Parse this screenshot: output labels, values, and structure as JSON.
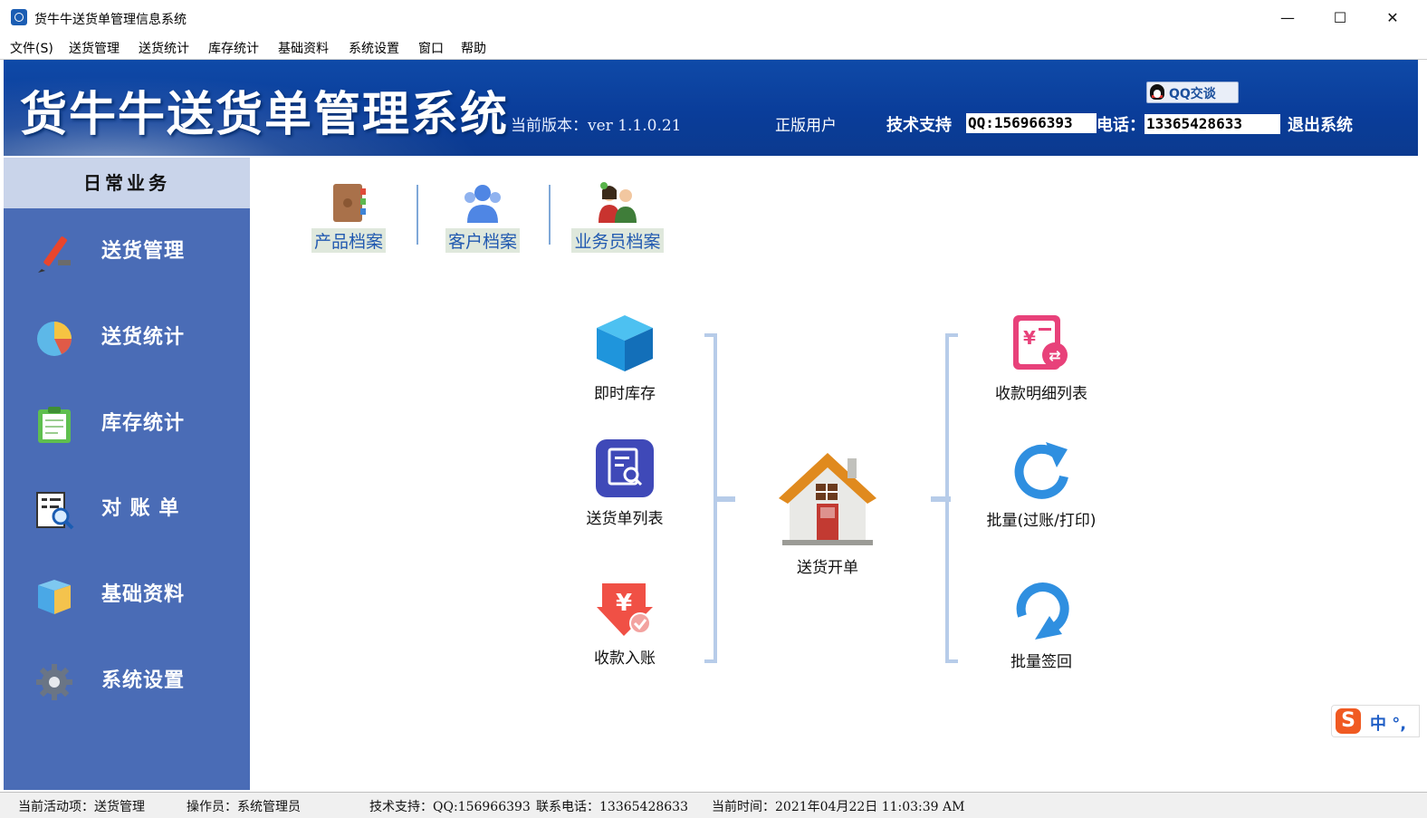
{
  "window": {
    "title": "货牛牛送货单管理信息系统",
    "controls": {
      "minimize": "—",
      "maximize": "☐",
      "close": "✕"
    }
  },
  "menubar": {
    "items": [
      "文件(S)",
      "送货管理",
      "送货统计",
      "库存统计",
      "基础资料",
      "系统设置",
      "窗口",
      "帮助"
    ]
  },
  "banner": {
    "title": "货牛牛送货单管理系统",
    "version": "当前版本：ver 1.1.0.21",
    "user_type": "正版用户",
    "support_label": "技术支持",
    "qq": "QQ:156966393",
    "tel_label": "电话：",
    "tel": "13365428633",
    "logout": "退出系统",
    "qq_chat": "QQ交谈"
  },
  "sidebar": {
    "header": "日常业务",
    "items": [
      {
        "label": "送货管理",
        "icon": "pen-icon"
      },
      {
        "label": "送货统计",
        "icon": "pie-chart-icon"
      },
      {
        "label": "库存统计",
        "icon": "clipboard-icon"
      },
      {
        "label": "对 账 单",
        "icon": "statement-search-icon"
      },
      {
        "label": "基础资料",
        "icon": "box-icon"
      },
      {
        "label": "系统设置",
        "icon": "gear-icon"
      }
    ]
  },
  "top_tiles": [
    {
      "label": "产品档案",
      "icon": "product-book-icon"
    },
    {
      "label": "客户档案",
      "icon": "customers-icon"
    },
    {
      "label": "业务员档案",
      "icon": "salesman-icon"
    }
  ],
  "functions": {
    "left": [
      {
        "label": "即时库存",
        "icon": "cube-icon"
      },
      {
        "label": "送货单列表",
        "icon": "document-list-icon"
      },
      {
        "label": "收款入账",
        "icon": "payment-in-icon"
      }
    ],
    "center": {
      "label": "送货开单",
      "icon": "house-icon"
    },
    "right": [
      {
        "label": "收款明细列表",
        "icon": "payment-detail-icon"
      },
      {
        "label": "批量(过账/打印)",
        "icon": "refresh-arrow-icon"
      },
      {
        "label": "批量签回",
        "icon": "return-arrow-icon"
      }
    ]
  },
  "statusbar": {
    "active": "当前活动项：送货管理",
    "operator": "操作员：系统管理员",
    "support": "技术支持：QQ:156966393",
    "phone": "联系电话：13365428633",
    "time": "当前时间：2021年04月22日 11:03:39 AM"
  },
  "ime": {
    "logo": "S",
    "text": "中 °,"
  },
  "colors": {
    "banner": "#0f4aa8",
    "sidebar": "#4a6cb6",
    "sidebar_header": "#c9d4ea",
    "tile_label": "#2159b0",
    "bracket": "#b7cce9"
  }
}
